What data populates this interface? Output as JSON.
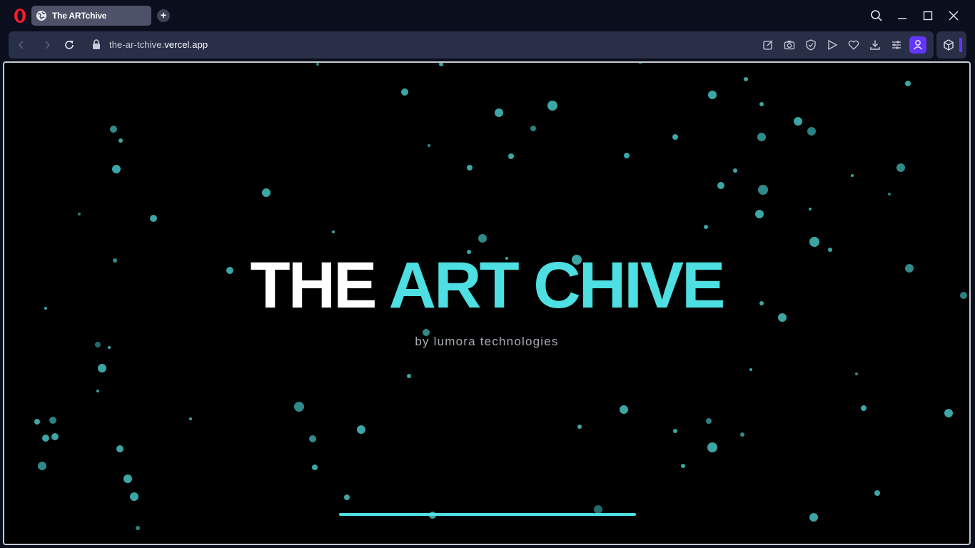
{
  "browser": {
    "tab_title": "The ARTchive",
    "url_prefix": "the-ar-tchive.",
    "url_host": "vercel.app",
    "icons": [
      "opera-logo-icon",
      "globe-icon",
      "plus-icon",
      "search-icon",
      "minimize-icon",
      "maximize-icon",
      "close-icon",
      "back-icon",
      "forward-icon",
      "reload-icon",
      "lock-icon",
      "edit-icon",
      "camera-icon",
      "shield-icon",
      "play-icon",
      "heart-icon",
      "download-icon",
      "settings-icon",
      "user-icon",
      "cube-icon"
    ],
    "accent_color": "#6236ff"
  },
  "page": {
    "title_part1": "THE",
    "title_part2": "ART CHIVE",
    "subtitle": "by lumora technologies",
    "accent_color": "#4ddfe1",
    "background": "#000000"
  }
}
